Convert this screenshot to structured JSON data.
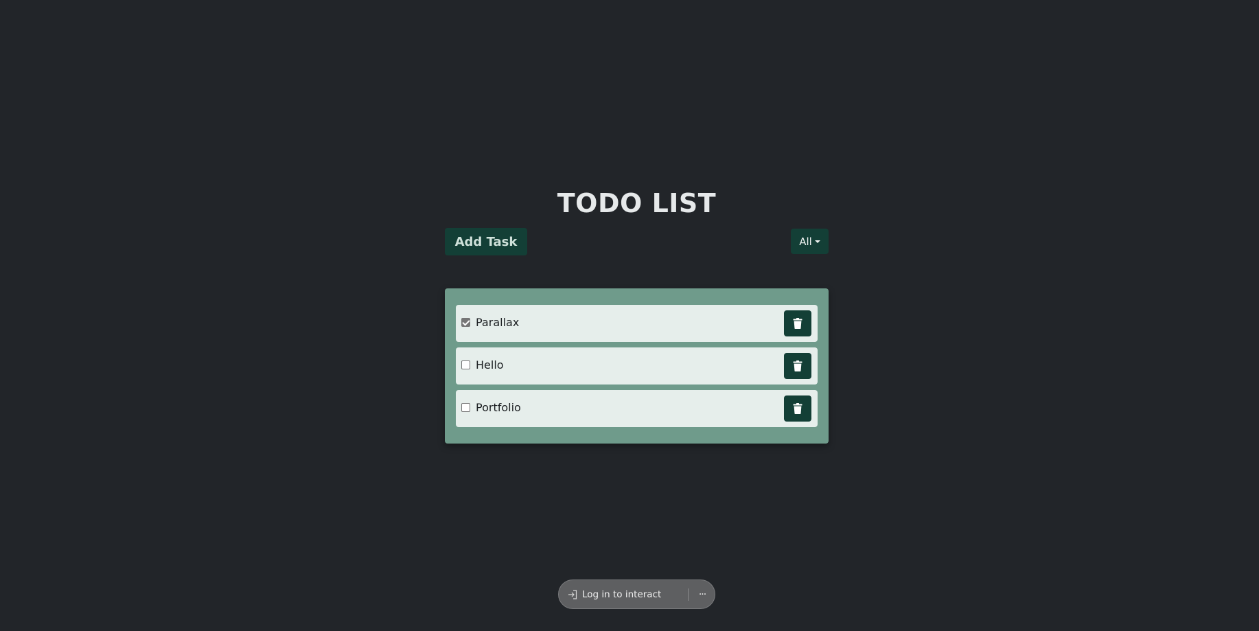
{
  "header": {
    "title": "TODO LIST"
  },
  "toolbar": {
    "add_label": "Add Task",
    "filter_label": "All",
    "filter_icon": "caret-down-icon"
  },
  "todos": [
    {
      "label": "Parallax",
      "checked": true,
      "delete_icon": "trash-icon"
    },
    {
      "label": "Hello",
      "checked": false,
      "delete_icon": "trash-icon"
    },
    {
      "label": "Portfolio",
      "checked": false,
      "delete_icon": "trash-icon"
    }
  ],
  "footer": {
    "login_label": "Log in to interact",
    "login_icon": "login-arrow-icon",
    "more_label": "···"
  },
  "colors": {
    "background": "#222529",
    "accent": "#133f36",
    "panel": "#6f9b8b",
    "row": "#e6eeeb"
  }
}
